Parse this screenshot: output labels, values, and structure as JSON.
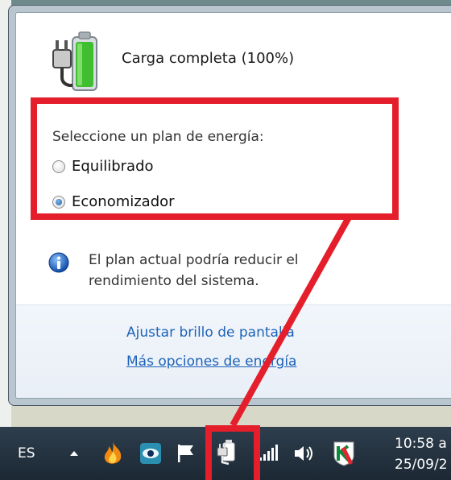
{
  "power_popup": {
    "status": "Carga completa (100%)",
    "plan_prompt": "Seleccione un plan de energía:",
    "plans": [
      {
        "label": "Equilibrado",
        "selected": false
      },
      {
        "label": "Economizador",
        "selected": true
      }
    ],
    "info_line1": "El plan actual podría reducir el",
    "info_line2": "rendimiento del sistema.",
    "links": {
      "brightness": "Ajustar brillo de pantalla",
      "more_options": "Más opciones de energía"
    }
  },
  "taskbar": {
    "language": "ES",
    "time": "10:58 a",
    "date": "25/09/2",
    "tray_icons": [
      "show-hidden-icons-arrow",
      "flame-app-icon",
      "eye-app-icon",
      "action-center-flag-icon",
      "power-plug-icon",
      "network-signal-icon",
      "volume-icon",
      "antivirus-icon"
    ]
  },
  "colors": {
    "annotation": "#e41e2a",
    "link": "#1d63b8",
    "taskbar": "#1c2834"
  }
}
